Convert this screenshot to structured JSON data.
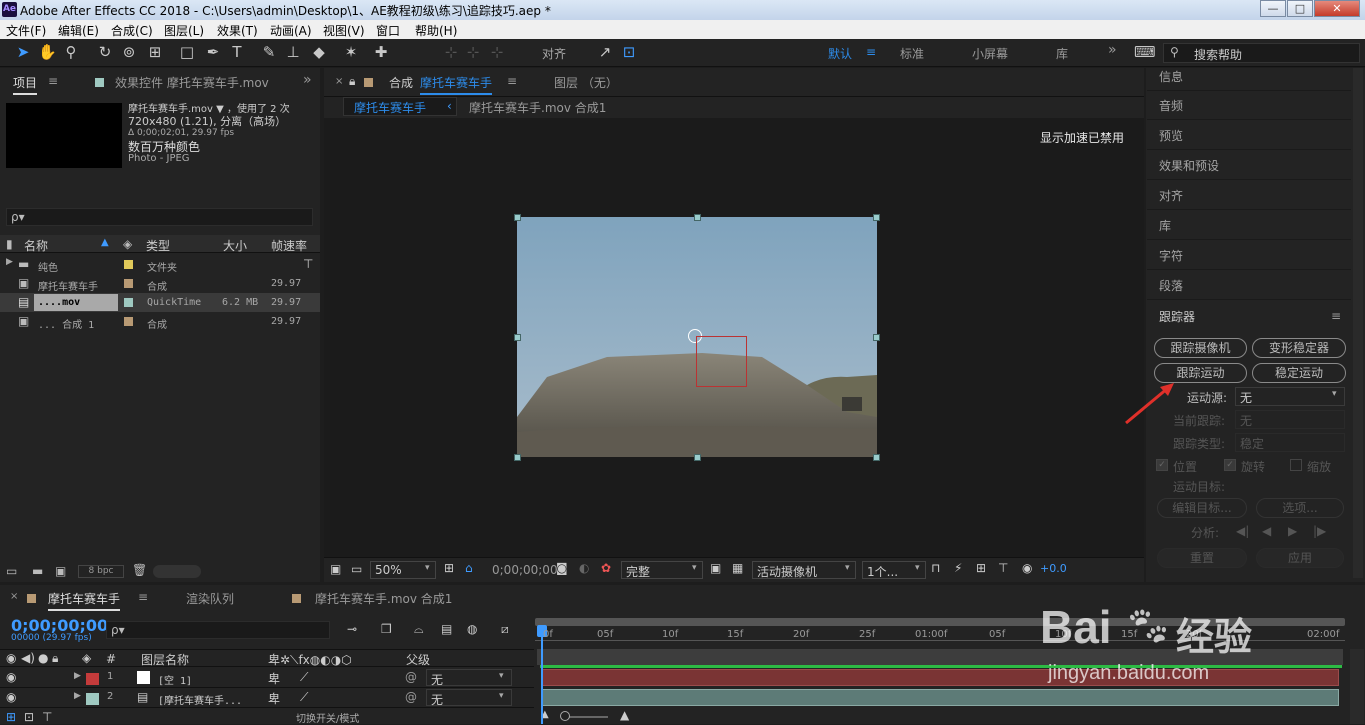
{
  "window": {
    "title": "Adobe After Effects CC 2018 - C:\\Users\\admin\\Desktop\\1、AE教程初级\\练习\\追踪技巧.aep *",
    "app_icon": "Ae",
    "minimize": "—",
    "maximize": "□",
    "close": "✕"
  },
  "menu": [
    "文件(F)",
    "编辑(E)",
    "合成(C)",
    "图层(L)",
    "效果(T)",
    "动画(A)",
    "视图(V)",
    "窗口",
    "帮助(H)"
  ],
  "toolbar": {
    "align_label": "对齐",
    "workspaces": [
      "默认",
      "标准",
      "小屏幕",
      "库"
    ],
    "more": "»",
    "search_placeholder": "搜索帮助"
  },
  "project": {
    "tab_project": "项目",
    "tab_effects": "效果控件 摩托车赛车手.mov",
    "more": "»",
    "info_name": "摩托车赛车手.mov ▼ ，使用了 2 次",
    "info_res": "720x480 (1.21), 分离（高场）",
    "info_dur": "Δ 0;00;02;01, 29.97 fps",
    "info_color": "数百万种颜色",
    "info_codec": "Photo - JPEG",
    "search_placeholder": "ρ▾",
    "headers": {
      "name": "名称",
      "type": "类型",
      "size": "大小",
      "fps": "帧速率"
    },
    "rows": [
      {
        "name": "纯色",
        "type": "文件夹",
        "size": "",
        "fps": "",
        "color": "#e0c95a"
      },
      {
        "name": "摩托车赛车手",
        "type": "合成",
        "size": "",
        "fps": "29.97",
        "color": "#b89a74"
      },
      {
        "name": "....mov",
        "type": "QuickTime",
        "size": "6.2 MB",
        "fps": "29.97",
        "color": "#9fc9c1"
      },
      {
        "name": "... 合成 1",
        "type": "合成",
        "size": "",
        "fps": "29.97",
        "color": "#b89a74"
      }
    ],
    "bpc": "8 bpc"
  },
  "comp": {
    "tab_label": "合成",
    "tab_name": "摩托车赛车手",
    "layer_tab": "图层 （无）",
    "crumb_active": "摩托车赛车手",
    "crumb_other": "摩托车赛车手.mov 合成1",
    "accel_msg": "显示加速已禁用",
    "zoom": "50%",
    "timecode": "0;00;00;00",
    "quality": "完整",
    "camera": "活动摄像机",
    "views": "1个...",
    "exposure": "+0.0"
  },
  "right_panel": {
    "items": [
      "信息",
      "音频",
      "预览",
      "效果和预设",
      "对齐",
      "库",
      "字符",
      "段落"
    ],
    "tracker_title": "跟踪器",
    "btn_camera": "跟踪摄像机",
    "btn_warp": "变形稳定器",
    "btn_motion": "跟踪运动",
    "btn_stabilize": "稳定运动",
    "source_label": "运动源:",
    "source_value": "无",
    "current_label": "当前跟踪:",
    "current_value": "无",
    "type_label": "跟踪类型:",
    "type_value": "稳定",
    "cb_position": "位置",
    "cb_rotation": "旋转",
    "cb_scale": "缩放",
    "target_label": "运动目标:",
    "btn_edit": "编辑目标...",
    "btn_options": "选项...",
    "analyze_label": "分析:",
    "btn_reset": "重置",
    "btn_apply": "应用"
  },
  "timeline": {
    "tab_comp": "摩托车赛车手",
    "tab_render": "渲染队列",
    "tab_other": "摩托车赛车手.mov 合成1",
    "timecode": "0;00;00;00",
    "fps_label": "00000 (29.97 fps)",
    "search_placeholder": "ρ▾",
    "col_layer": "图层名称",
    "col_parent": "父级",
    "col_num": "#",
    "ruler": [
      "0f",
      "05f",
      "10f",
      "15f",
      "20f",
      "25f",
      "01:00f",
      "05f",
      "10f",
      "15f",
      "20f",
      "02:00f"
    ],
    "layers": [
      {
        "num": "1",
        "name": "[空 1]",
        "parent": "无",
        "color": "#c43b3b"
      },
      {
        "num": "2",
        "name": "[摩托车赛车手...",
        "parent": "无",
        "color": "#9fc9c1"
      }
    ],
    "toggle_label": "切换开关/模式"
  },
  "watermark": {
    "brand": "Bai",
    "brand2": "经验",
    "url": "jingyan.baidu.com"
  },
  "colors": {
    "accent": "#2d8ceb",
    "panel": "#232323",
    "bg": "#1d1d1d",
    "layer1_bar": "#7a3434",
    "layer2_bar": "#5d7b77"
  }
}
